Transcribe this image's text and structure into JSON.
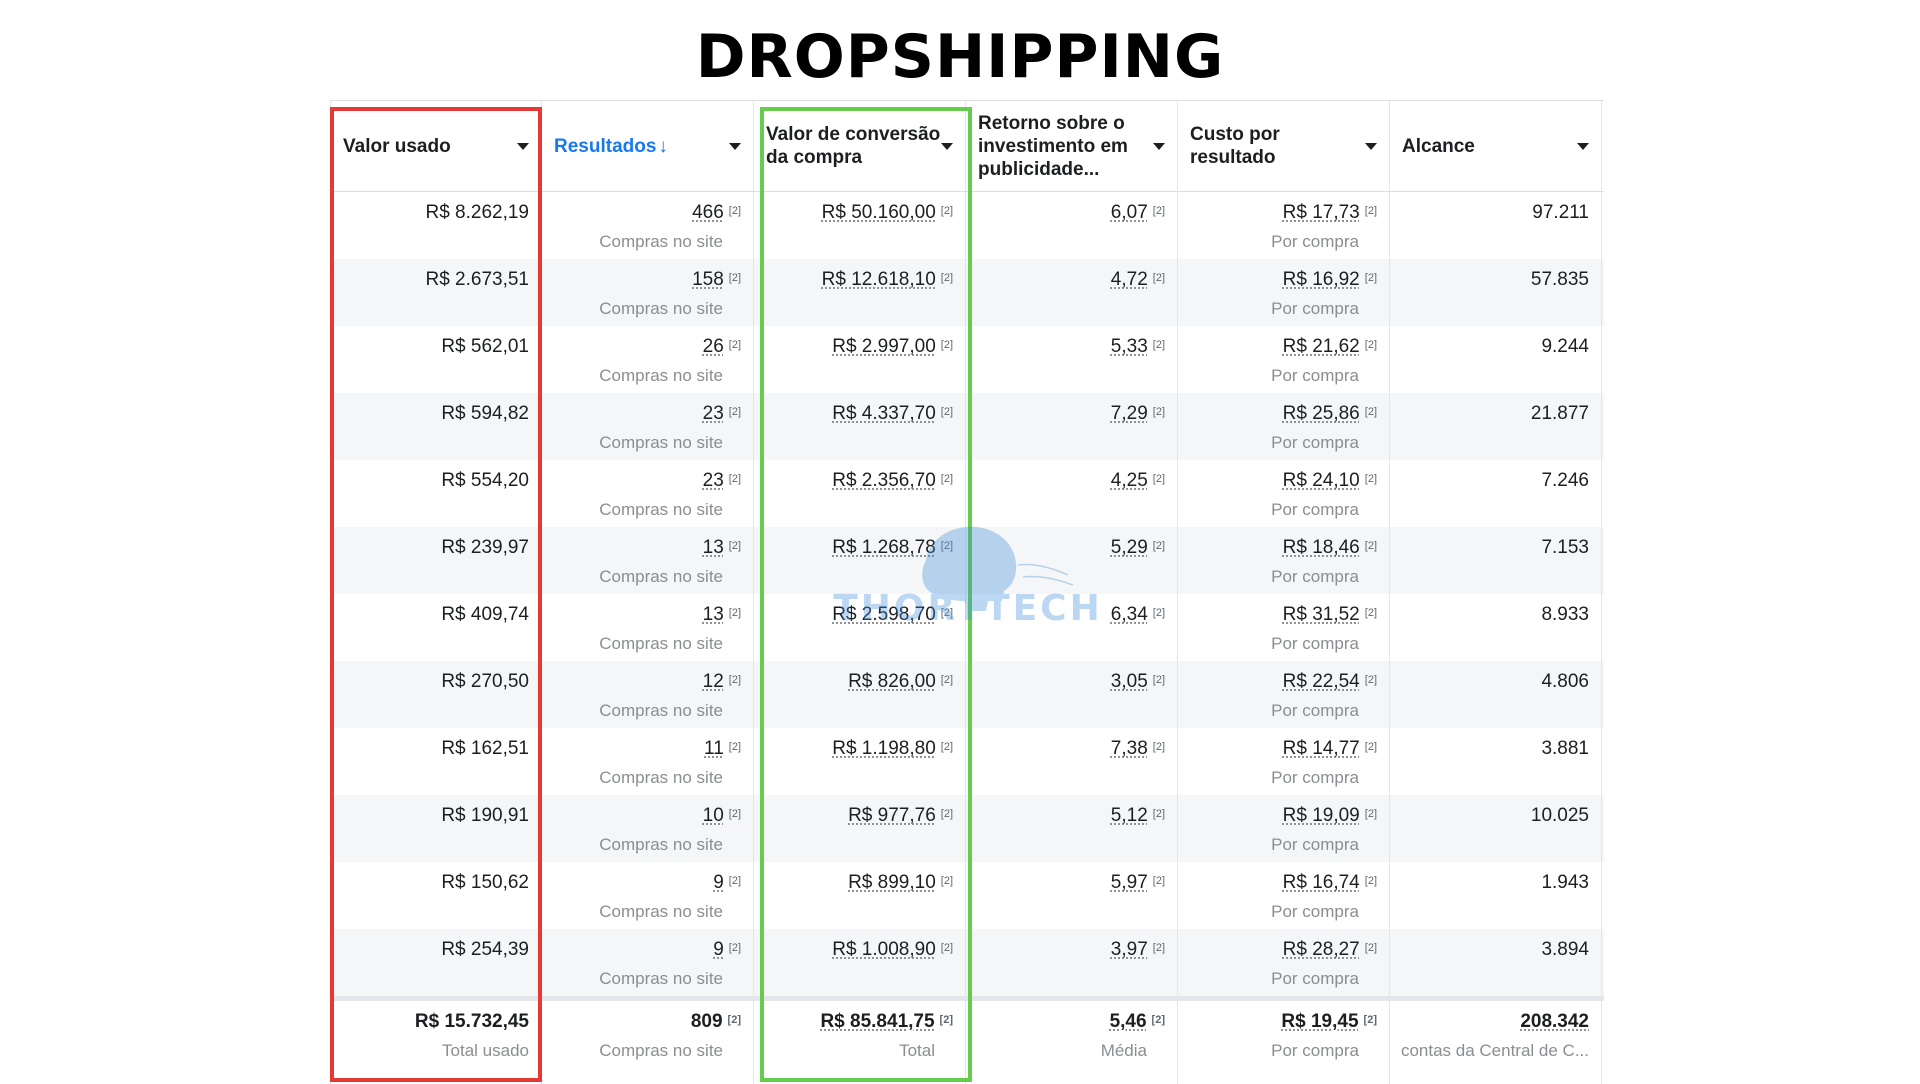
{
  "page": {
    "title": "DROPSHIPPING"
  },
  "colors": {
    "sorted_header": "#1877f2",
    "highlight_red": "#e53935",
    "highlight_green": "#66cc4c",
    "watermark": "#3f8fd8"
  },
  "watermark": {
    "text": "THORTTECH"
  },
  "footnote_mark": "[2]",
  "headers": [
    {
      "label": "Valor usado",
      "sorted": false
    },
    {
      "label": "Resultados",
      "sorted": true,
      "sort_icon": "arrow-down-icon",
      "arrow": "↓"
    },
    {
      "label": "Valor de conversão da compra",
      "sorted": false
    },
    {
      "label": "Retorno sobre o investimento em publicidade...",
      "sorted": false
    },
    {
      "label": "Custo por resultado",
      "sorted": false
    },
    {
      "label": "Alcance",
      "sorted": false
    }
  ],
  "rows": [
    {
      "spent": "R$ 8.262,19",
      "results": "466",
      "results_sub": "Compras no site",
      "conversion": "R$ 50.160,00",
      "roas": "6,07",
      "cost": "R$ 17,73",
      "cost_sub": "Por compra",
      "reach": "97.211"
    },
    {
      "spent": "R$ 2.673,51",
      "results": "158",
      "results_sub": "Compras no site",
      "conversion": "R$ 12.618,10",
      "roas": "4,72",
      "cost": "R$ 16,92",
      "cost_sub": "Por compra",
      "reach": "57.835"
    },
    {
      "spent": "R$ 562,01",
      "results": "26",
      "results_sub": "Compras no site",
      "conversion": "R$ 2.997,00",
      "roas": "5,33",
      "cost": "R$ 21,62",
      "cost_sub": "Por compra",
      "reach": "9.244"
    },
    {
      "spent": "R$ 594,82",
      "results": "23",
      "results_sub": "Compras no site",
      "conversion": "R$ 4.337,70",
      "roas": "7,29",
      "cost": "R$ 25,86",
      "cost_sub": "Por compra",
      "reach": "21.877"
    },
    {
      "spent": "R$ 554,20",
      "results": "23",
      "results_sub": "Compras no site",
      "conversion": "R$ 2.356,70",
      "roas": "4,25",
      "cost": "R$ 24,10",
      "cost_sub": "Por compra",
      "reach": "7.246"
    },
    {
      "spent": "R$ 239,97",
      "results": "13",
      "results_sub": "Compras no site",
      "conversion": "R$ 1.268,78",
      "roas": "5,29",
      "cost": "R$ 18,46",
      "cost_sub": "Por compra",
      "reach": "7.153"
    },
    {
      "spent": "R$ 409,74",
      "results": "13",
      "results_sub": "Compras no site",
      "conversion": "R$ 2.598,70",
      "roas": "6,34",
      "cost": "R$ 31,52",
      "cost_sub": "Por compra",
      "reach": "8.933"
    },
    {
      "spent": "R$ 270,50",
      "results": "12",
      "results_sub": "Compras no site",
      "conversion": "R$ 826,00",
      "roas": "3,05",
      "cost": "R$ 22,54",
      "cost_sub": "Por compra",
      "reach": "4.806"
    },
    {
      "spent": "R$ 162,51",
      "results": "11",
      "results_sub": "Compras no site",
      "conversion": "R$ 1.198,80",
      "roas": "7,38",
      "cost": "R$ 14,77",
      "cost_sub": "Por compra",
      "reach": "3.881"
    },
    {
      "spent": "R$ 190,91",
      "results": "10",
      "results_sub": "Compras no site",
      "conversion": "R$ 977,76",
      "roas": "5,12",
      "cost": "R$ 19,09",
      "cost_sub": "Por compra",
      "reach": "10.025"
    },
    {
      "spent": "R$ 150,62",
      "results": "9",
      "results_sub": "Compras no site",
      "conversion": "R$ 899,10",
      "roas": "5,97",
      "cost": "R$ 16,74",
      "cost_sub": "Por compra",
      "reach": "1.943"
    },
    {
      "spent": "R$ 254,39",
      "results": "9",
      "results_sub": "Compras no site",
      "conversion": "R$ 1.008,90",
      "roas": "3,97",
      "cost": "R$ 28,27",
      "cost_sub": "Por compra",
      "reach": "3.894"
    }
  ],
  "totals": {
    "spent": "R$ 15.732,45",
    "spent_sub": "Total usado",
    "results": "809",
    "results_sub": "Compras no site",
    "conversion": "R$ 85.841,75",
    "conversion_sub": "Total",
    "roas": "5,46",
    "roas_sub": "Média",
    "cost": "R$ 19,45",
    "cost_sub": "Por compra",
    "reach": "208.342",
    "reach_sub": "contas da Central de C..."
  }
}
